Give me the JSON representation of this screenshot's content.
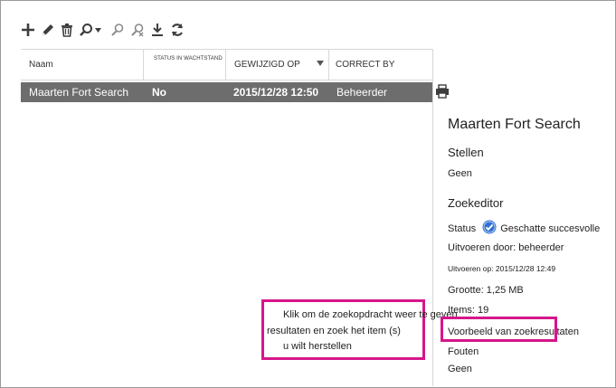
{
  "toolbar": {
    "buttons": [
      {
        "name": "new",
        "icon": "plus-icon"
      },
      {
        "name": "edit",
        "icon": "pencil-icon"
      },
      {
        "name": "delete",
        "icon": "trash-icon"
      },
      {
        "name": "search",
        "icon": "search-icon",
        "has_dropdown": true
      },
      {
        "name": "search-people",
        "icon": "person-search-icon"
      },
      {
        "name": "search-remove",
        "icon": "person-search-remove-icon"
      },
      {
        "name": "export",
        "icon": "download-icon"
      },
      {
        "name": "refresh",
        "icon": "refresh-icon"
      }
    ]
  },
  "grid": {
    "columns": {
      "name": "Naam",
      "status": "STATUS IN WACHTSTAND",
      "modified": "GEWIJZIGD OP",
      "by": "CORRECT BY"
    },
    "sorted_column": "modified",
    "rows": [
      {
        "name": "Maarten Fort Search",
        "status": "No",
        "modified": "2015/12/28 12:50",
        "by": "Beheerder",
        "selected": true
      }
    ]
  },
  "details": {
    "title": "Maarten Fort Search",
    "section_stellen": "Stellen",
    "stellen_value": "Geen",
    "section_editor": "Zoekeditor",
    "status_label": "Status",
    "status_value": "Geschatte succesvolle",
    "status_color": "#2f6fd0",
    "run_by": "Uitvoeren door: beheerder",
    "run_on": "Uitvoeren op: 2015/12/28 12:49",
    "size": "Grootte: 1,25 MB",
    "items": "Items: 19",
    "preview_link": "Voorbeeld van zoekresultaten",
    "errors_label": "Fouten",
    "errors_value": "Geen"
  },
  "callout": {
    "line1": "Klik om de zoekopdracht weer te geven",
    "line2": "resultaten en zoek het item (s)",
    "line3": "u wilt herstellen",
    "color": "#d6168a"
  }
}
